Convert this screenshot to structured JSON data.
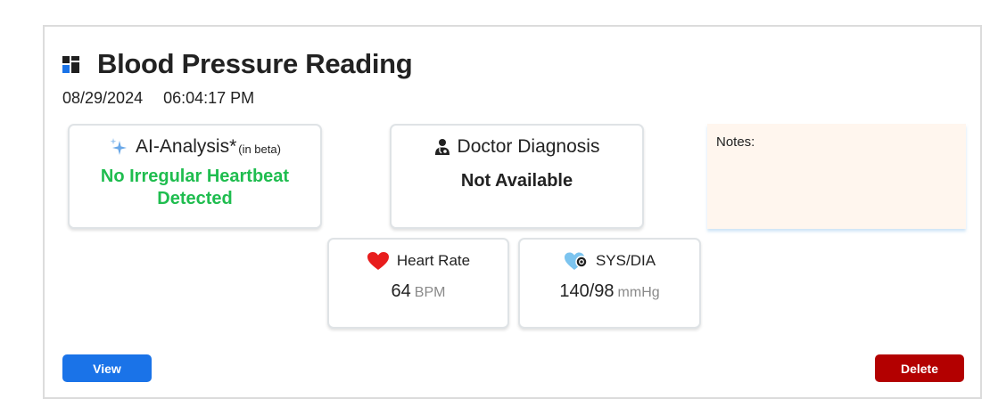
{
  "header": {
    "title": "Blood Pressure Reading",
    "date": "08/29/2024",
    "time": "06:04:17 PM"
  },
  "ai_analysis": {
    "title": "AI-Analysis*",
    "beta": "(in beta)",
    "result_line1": "No Irregular Heartbeat",
    "result_line2": "Detected",
    "result_color": "#1fbd4f"
  },
  "doctor_diagnosis": {
    "title": "Doctor Diagnosis",
    "result": "Not Available"
  },
  "notes": {
    "label": "Notes:"
  },
  "heart_rate": {
    "title": "Heart Rate",
    "value": "64",
    "unit": "BPM"
  },
  "sys_dia": {
    "title": "SYS/DIA",
    "value": "140/98",
    "unit": "mmHg"
  },
  "actions": {
    "view_label": "View",
    "delete_label": "Delete",
    "view_color": "#1a73e8",
    "delete_color": "#b30000"
  },
  "icons": {
    "title": "dashboard-grid-icon",
    "ai": "sparkles-icon",
    "doctor": "doctor-icon",
    "heart_rate": "heart-icon",
    "sys_dia": "heart-pulse-icon"
  }
}
